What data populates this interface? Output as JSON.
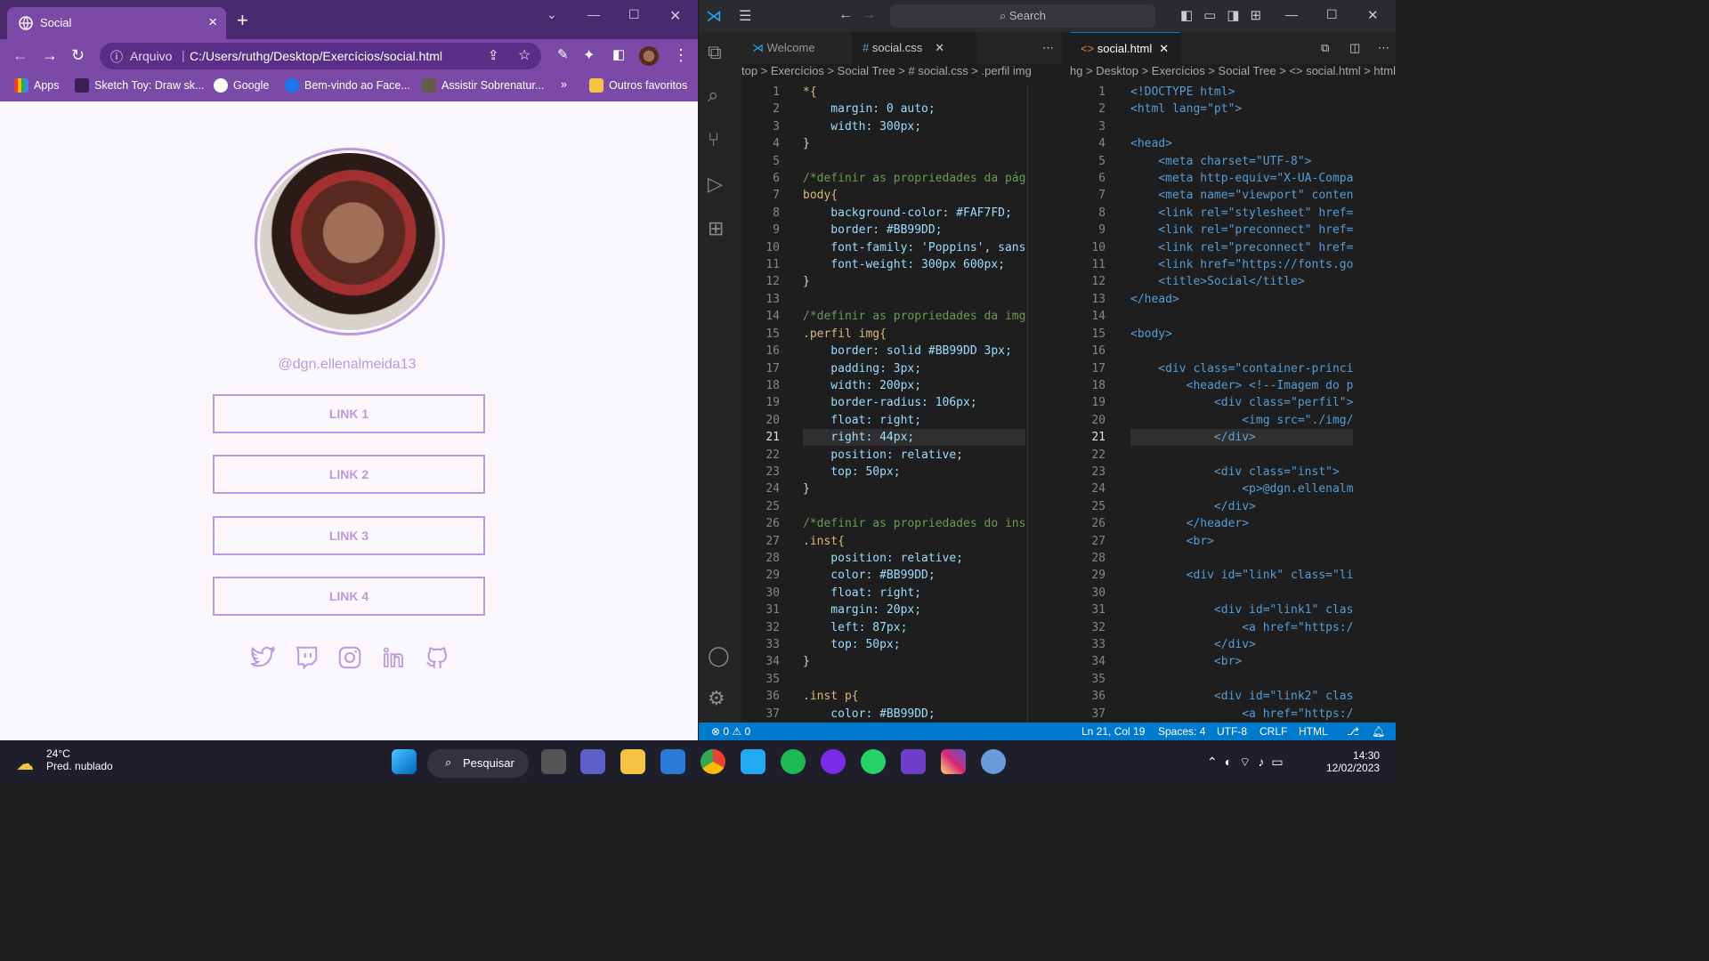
{
  "browser": {
    "tab_title": "Social",
    "address_label": "Arquivo",
    "url": "C:/Users/ruthg/Desktop/Exercícios/social.html",
    "bookmarks": [
      {
        "label": "Apps"
      },
      {
        "label": "Sketch Toy: Draw sk..."
      },
      {
        "label": "Google"
      },
      {
        "label": "Bem-vindo ao Face..."
      },
      {
        "label": "Assistir Sobrenatur..."
      },
      {
        "label": "»"
      },
      {
        "label": "Outros favoritos"
      }
    ]
  },
  "page": {
    "instagram_handle": "@dgn.ellenalmeida13",
    "links": [
      "LINK 1",
      "LINK 2",
      "LINK 3",
      "LINK 4"
    ],
    "social_icons": [
      "twitter-icon",
      "twitch-icon",
      "instagram-icon",
      "linkedin-icon",
      "github-icon"
    ],
    "accent_color": "#BB99DD",
    "background_color": "#FAF7FD"
  },
  "vscode": {
    "search_placeholder": "Search",
    "tabs_left": [
      "Welcome",
      "social.css"
    ],
    "tabs_right": [
      "social.html"
    ],
    "breadcrumb_left": "top > Exercícios > Social Tree > # social.css > .perfil img",
    "breadcrumb_right": "hg > Desktop > Exercícios > Social Tree > <> social.html > html",
    "css_lines": [
      "*{",
      "    margin: 0 auto;",
      "    width: 300px;",
      "}",
      "",
      "/*definir as propriedades da pág",
      "body{",
      "    background-color: #FAF7FD;",
      "    border: #BB99DD;",
      "    font-family: 'Poppins', sans",
      "    font-weight: 300px 600px;",
      "}",
      "",
      "/*definir as propriedades da img",
      ".perfil img{",
      "    border: solid #BB99DD 3px;",
      "    padding: 3px;",
      "    width: 200px;",
      "    border-radius: 106px;",
      "    float: right;",
      "    right: 44px;",
      "    position: relative;",
      "    top: 50px;",
      "}",
      "",
      "/*definir as propriedades do ins",
      ".inst{",
      "    position: relative;",
      "    color: #BB99DD;",
      "    float: right;",
      "    margin: 20px;",
      "    left: 87px;",
      "    top: 50px;",
      "}",
      "",
      ".inst p{",
      "    color: #BB99DD;"
    ],
    "html_lines": [
      "<!DOCTYPE html>",
      "<html lang=\"pt\">",
      "",
      "<head>",
      "    <meta charset=\"UTF-8\">",
      "    <meta http-equiv=\"X-UA-Compa",
      "    <meta name=\"viewport\" conten",
      "    <link rel=\"stylesheet\" href=",
      "    <link rel=\"preconnect\" href=",
      "    <link rel=\"preconnect\" href=",
      "    <link href=\"https://fonts.go",
      "    <title>Social</title>",
      "</head>",
      "",
      "<body>",
      "",
      "    <div class=\"container-princi",
      "        <header> <!--Imagem do p",
      "            <div class=\"perfil\">",
      "                <img src=\"./img/",
      "            </div>",
      "",
      "            <div class=\"inst\">",
      "                <p>@dgn.ellenalm",
      "            </div>",
      "        </header>",
      "        <br>",
      "",
      "        <div id=\"link\" class=\"li",
      "",
      "            <div id=\"link1\" clas",
      "                <a href=\"https:/",
      "            </div>",
      "            <br>",
      "",
      "            <div id=\"link2\" clas",
      "                <a href=\"https:/"
    ],
    "status": {
      "problems": "⊗ 0 ⚠ 0",
      "position": "Ln 21, Col 19",
      "spaces": "Spaces: 4",
      "encoding": "UTF-8",
      "eol": "CRLF",
      "language": "HTML"
    }
  },
  "taskbar": {
    "temperature": "24°C",
    "weather": "Pred. nublado",
    "search_label": "Pesquisar",
    "time": "14:30",
    "date": "12/02/2023"
  }
}
